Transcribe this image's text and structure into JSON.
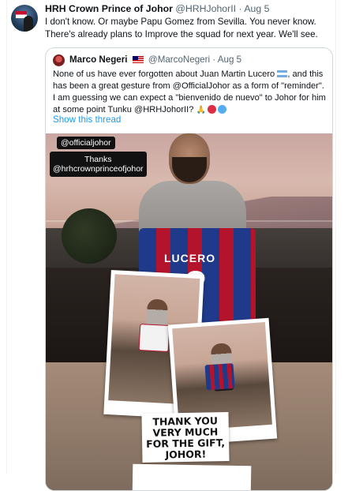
{
  "tweet": {
    "display_name": "HRH Crown Prince of Johor",
    "handle": "@HRHJohorII",
    "separator": "·",
    "date": "Aug 5",
    "text": "I don't know. Or maybe Papu Gomez from Sevilla. You never know. There's already plans to Improve the squad for next year. We'll see."
  },
  "quoted_tweet": {
    "display_name": "Marco Negeri",
    "flag_icon": "malaysia-flag-icon",
    "handle": "@MarcoNegeri",
    "separator": "·",
    "date": "Aug 5",
    "text_part_1": "None of us have ever forgotten about Juan Martin Lucero",
    "flag_icon_2": "argentina-flag-icon",
    "text_part_2": ", and this has been a great gesture from @OfficialJohor as a form of \"reminder\". I am guessing we can expect a \"bienvenido de nuevo\" to Johor for him at some point Tunku @HRHJohorII?",
    "emojis": [
      "folded-hands-icon",
      "red-circle-icon",
      "blue-circle-icon"
    ],
    "show_thread_label": "Show this thread"
  },
  "media": {
    "sticker_1": "@officialjohor",
    "sticker_2_line_1": "Thanks",
    "sticker_2_line_2": "@hrhcrownprinceofjohor",
    "jersey_name": "LUCERO",
    "jersey_number": "?",
    "card_text": "THANK YOU VERY MUCH FOR THE GIFT, JOHOR!"
  },
  "colors": {
    "link": "#1d9bf0",
    "secondary_text": "#536471",
    "border": "#cfd9de"
  }
}
